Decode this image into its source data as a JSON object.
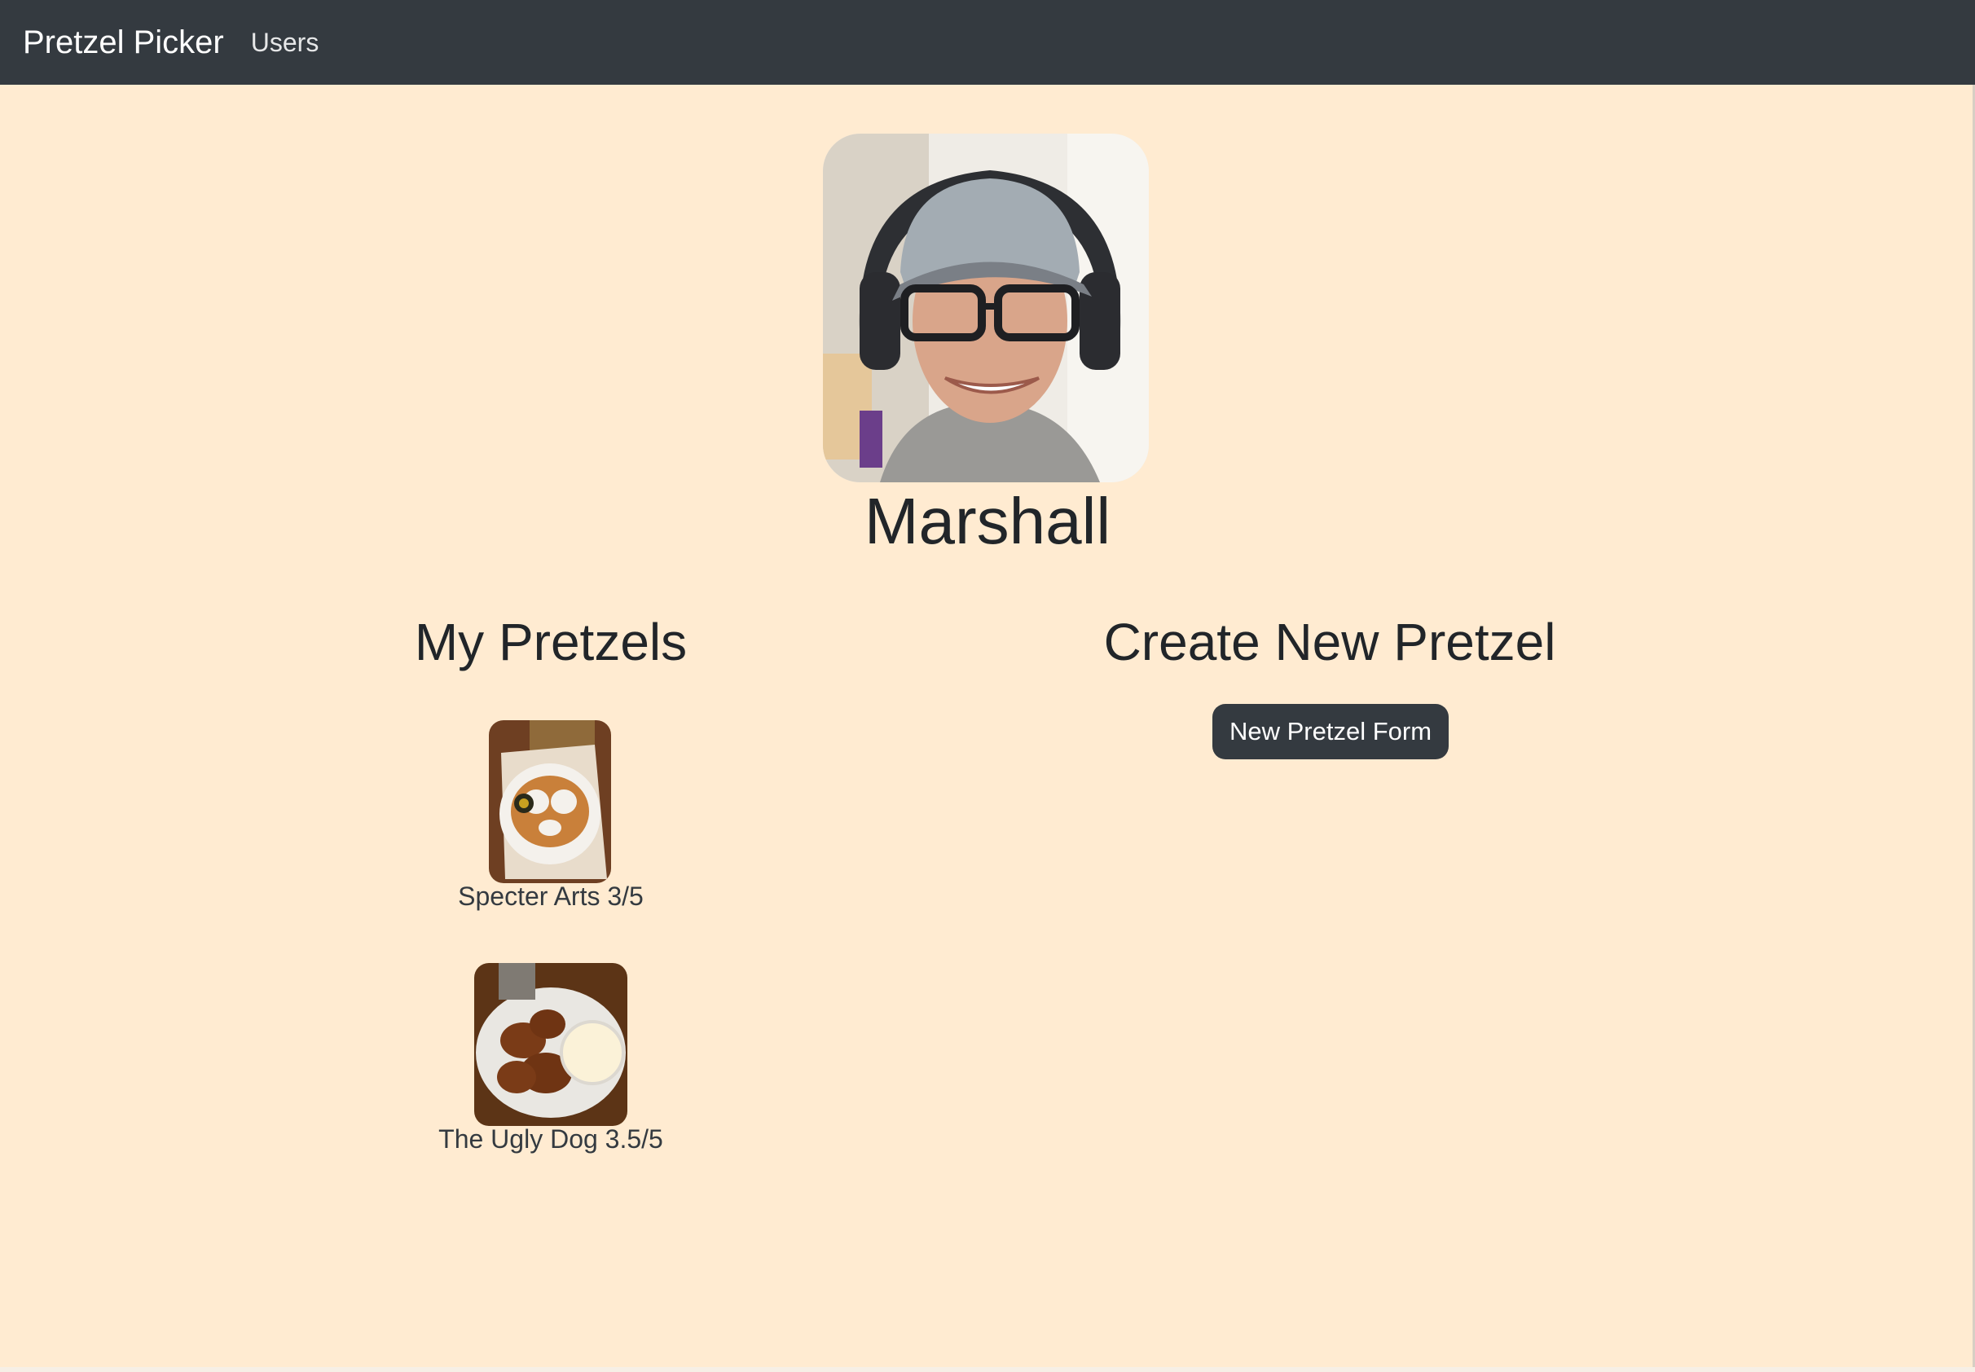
{
  "nav": {
    "brand": "Pretzel Picker",
    "users_link": "Users"
  },
  "profile": {
    "name": "Marshall",
    "avatar_icon": "user-photo"
  },
  "my_pretzels": {
    "heading": "My Pretzels",
    "items": [
      {
        "label": "Specter Arts 3/5",
        "image": "pretzel-photo"
      },
      {
        "label": "The Ugly Dog 3.5/5",
        "image": "pretzel-photo"
      }
    ]
  },
  "create": {
    "heading": "Create New Pretzel",
    "button_label": "New Pretzel Form"
  },
  "colors": {
    "background": "#ffebd1",
    "navbar": "#343a40",
    "button": "#343a40",
    "text": "#212529"
  }
}
